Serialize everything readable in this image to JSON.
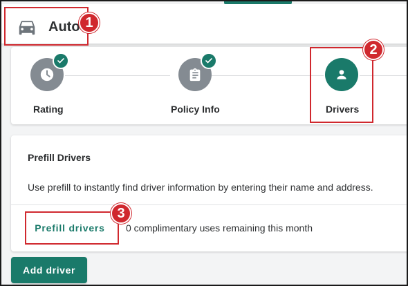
{
  "header": {
    "title": "Auto",
    "icon": "car-icon"
  },
  "annotations": [
    "1",
    "2",
    "3"
  ],
  "steps": [
    {
      "label": "Rating",
      "icon": "clock-icon",
      "status": "complete"
    },
    {
      "label": "Policy Info",
      "icon": "clipboard-icon",
      "status": "complete"
    },
    {
      "label": "Drivers",
      "icon": "person-icon",
      "status": "active"
    }
  ],
  "prefill": {
    "title": "Prefill Drivers",
    "description": "Use prefill to instantly find driver information by entering their name and address.",
    "button_label": "Prefill drivers",
    "uses_text": "0 complimentary uses remaining this month"
  },
  "add_driver_label": "Add driver",
  "colors": {
    "accent": "#1a7a6a",
    "annotation": "#d0282e",
    "step_done": "#848b92"
  }
}
